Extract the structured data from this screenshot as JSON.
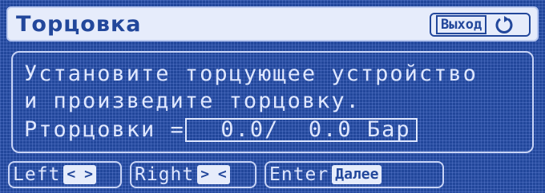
{
  "header": {
    "title": "Торцовка",
    "exit_label": "Выход",
    "exit_icon": "return-arrow-icon"
  },
  "message": {
    "line1": "Установите торцующее устройство",
    "line2": "и произведите торцовку.",
    "pressure_label": "Pторцовки =",
    "pressure_value": "__0.0/__0.0 Бар"
  },
  "softkeys": {
    "left": {
      "label": "Left",
      "hint": "< >"
    },
    "right": {
      "label": "Right",
      "hint": "> <"
    },
    "enter": {
      "label": "Enter",
      "hint": "Далее"
    }
  },
  "colors": {
    "background": "#22479b",
    "text": "#dfe7ff",
    "title_bar": "#e6ecfb"
  }
}
